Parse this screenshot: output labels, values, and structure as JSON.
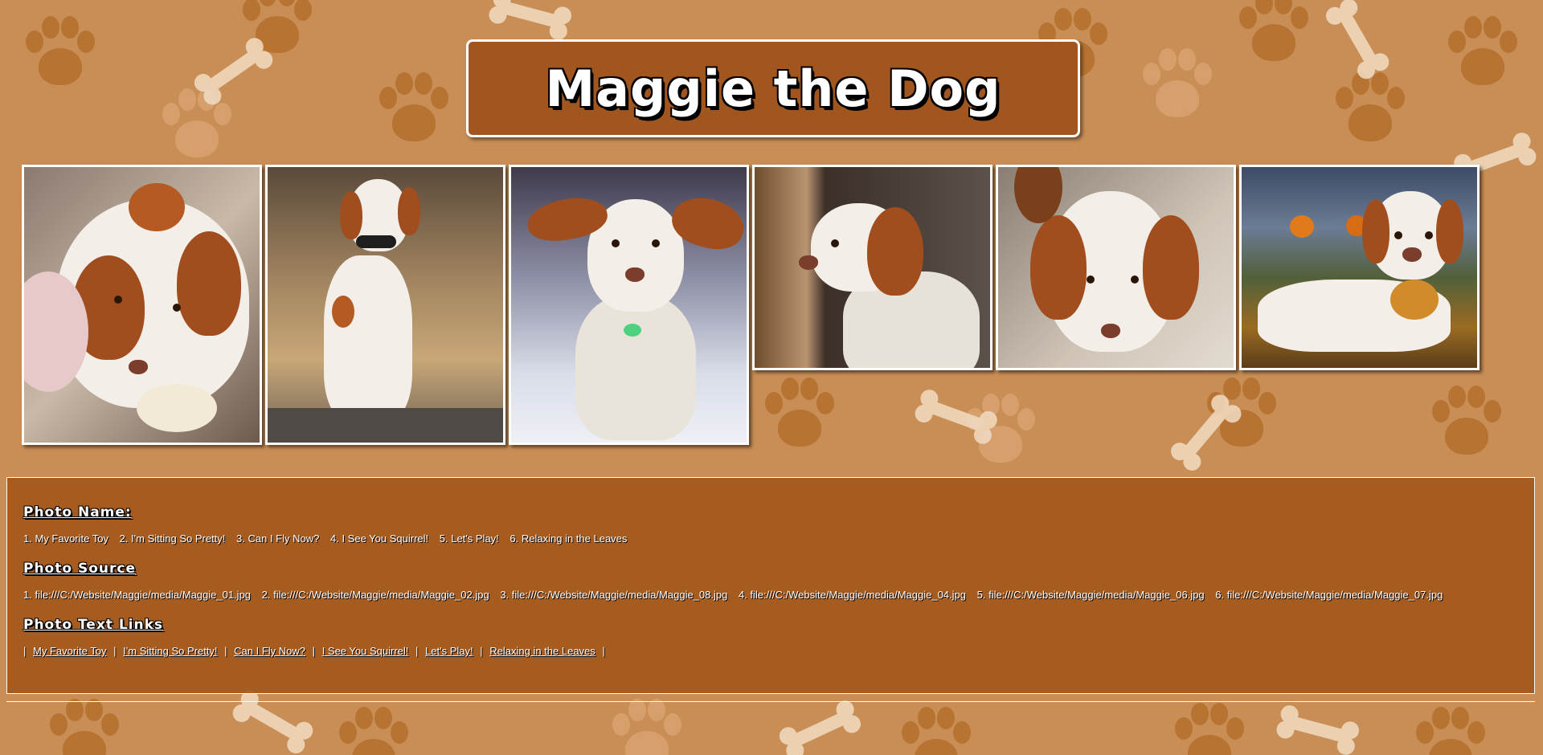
{
  "page": {
    "title": "Maggie the Dog"
  },
  "photos": [
    {
      "alt": "My Favorite Toy"
    },
    {
      "alt": "I'm Sitting So Pretty!"
    },
    {
      "alt": "Can I Fly Now?"
    },
    {
      "alt": "I See You Squirrel!"
    },
    {
      "alt": "Let's Play!"
    },
    {
      "alt": "Relaxing in the Leaves"
    }
  ],
  "info": {
    "photo_name_heading": "Photo Name:",
    "photo_names": [
      "1. My Favorite Toy",
      "2. I'm Sitting So Pretty!",
      "3. Can I Fly Now?",
      "4. I See You Squirrel!",
      "5. Let's Play!",
      "6. Relaxing in the Leaves"
    ],
    "photo_source_heading": "Photo Source",
    "photo_sources": [
      "1. file:///C:/Website/Maggie/media/Maggie_01.jpg",
      "2. file:///C:/Website/Maggie/media/Maggie_02.jpg",
      "3. file:///C:/Website/Maggie/media/Maggie_08.jpg",
      "4. file:///C:/Website/Maggie/media/Maggie_04.jpg",
      "5. file:///C:/Website/Maggie/media/Maggie_06.jpg",
      "6. file:///C:/Website/Maggie/media/Maggie_07.jpg"
    ],
    "photo_links_heading": "Photo Text Links",
    "separator": "|",
    "photo_links": [
      "My Favorite Toy",
      "I'm Sitting So Pretty!",
      "Can I Fly Now?",
      "I See You Squirrel!",
      "Let's Play!",
      "Relaxing in the Leaves"
    ]
  },
  "colors": {
    "background": "#c98e55",
    "panel": "#a2561f",
    "text": "#ffffff"
  }
}
